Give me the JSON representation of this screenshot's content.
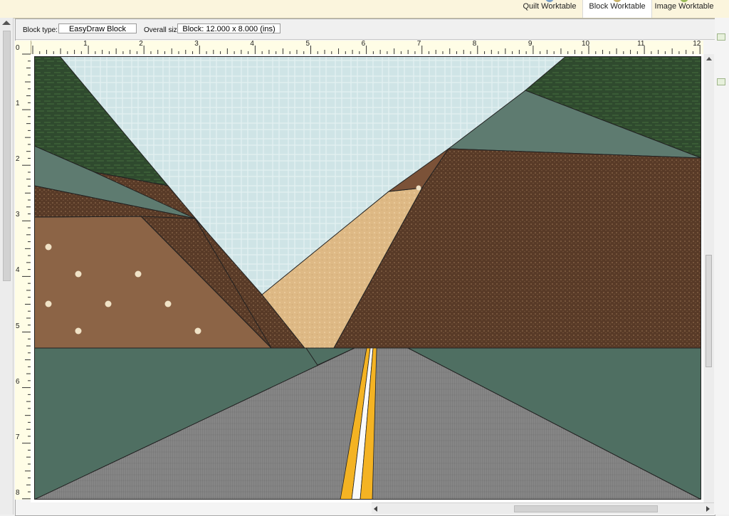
{
  "tabs": [
    {
      "label": "Quilt Worktable",
      "active": false,
      "icon": "quilt-worktable-icon",
      "color": "#7aa0c8"
    },
    {
      "label": "Block Worktable",
      "active": true,
      "icon": "block-worktable-icon",
      "color": "#c9b36a"
    },
    {
      "label": "Image Worktable",
      "active": false,
      "icon": "image-worktable-icon",
      "color": "#9bbb59"
    }
  ],
  "info": {
    "block_type_label": "Block type:",
    "block_type_value": "EasyDraw Block",
    "overall_size_label": "Overall size:",
    "overall_size_value": "Block: 12.000 x 8.000 (ins)"
  },
  "ruler": {
    "top_numbers": [
      "0",
      "1",
      "2",
      "3",
      "4",
      "5",
      "6",
      "7",
      "8",
      "9",
      "10",
      "11",
      "12"
    ],
    "left_numbers": [
      "0",
      "1",
      "2",
      "3",
      "4",
      "5",
      "6",
      "7",
      "8"
    ]
  },
  "colors": {
    "sky": "#cfe4e6",
    "dark_green": "#2f4a2e",
    "slate": "#5e7b70",
    "brown": "#5a3b28",
    "light_brown": "#8c6446",
    "sand": "#ddb985",
    "road_green": "#4f6f62",
    "asphalt": "#7e7e7e",
    "yellow_line": "#f4b323",
    "white_line": "#fafafa"
  }
}
